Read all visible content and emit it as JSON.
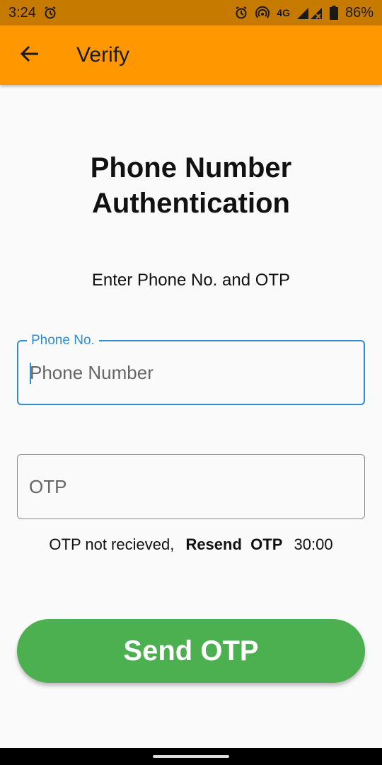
{
  "status_bar": {
    "time": "3:24",
    "network": "4G",
    "battery": "86%",
    "icons": [
      "alarm-icon",
      "hotspot-icon",
      "signal-icon",
      "battery-icon"
    ]
  },
  "app_bar": {
    "title": "Verify",
    "back_icon": "arrow-left-icon",
    "color": "#ff9800"
  },
  "main": {
    "heading_line1": "Phone Number",
    "heading_line2": "Authentication",
    "subheading": "Enter Phone No. and OTP",
    "phone_field": {
      "label": "Phone No.",
      "placeholder": "Phone Number",
      "value": ""
    },
    "otp_field": {
      "placeholder": "OTP",
      "value": ""
    },
    "resend": {
      "prefix": "OTP not recieved,",
      "link_word1": "Resend",
      "link_word2": "OTP",
      "timer": "30:00"
    },
    "send_button_label": "Send OTP",
    "accent_color": "#2f8dd6",
    "button_color": "#4caf50"
  }
}
